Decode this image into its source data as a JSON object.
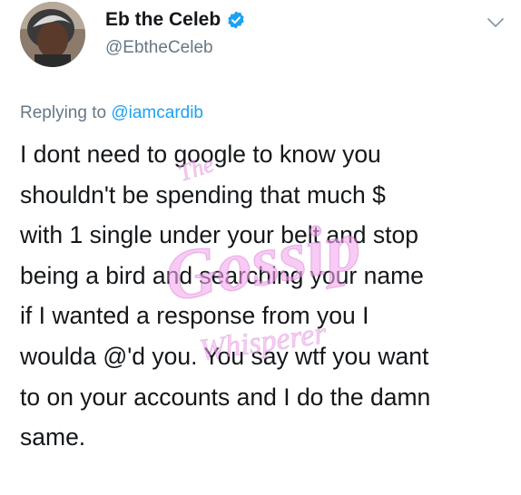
{
  "author": {
    "display_name": "Eb the Celeb",
    "handle": "@EbtheCeleb",
    "verified": true
  },
  "icons": {
    "verified": "verified-badge-icon",
    "more": "chevron-down-icon"
  },
  "reply": {
    "prefix": "Replying to ",
    "mention": "@iamcardib"
  },
  "tweet": {
    "lines": [
      "I dont need to google to know you",
      "shouldn't be spending that much $",
      "with 1 single under your belt and stop",
      "being a bird and searching your name",
      "if I wanted a response from you I",
      "woulda @'d you. You say wtf you want",
      "to on your accounts and I do the damn",
      "same."
    ]
  },
  "watermark": {
    "top": "The",
    "main": "Gossip",
    "bottom": "Whisperer"
  },
  "colors": {
    "text": "#14171a",
    "secondary": "#657786",
    "link": "#1da1f2",
    "verified": "#1da1f2",
    "watermark": "#f3a6ef"
  }
}
